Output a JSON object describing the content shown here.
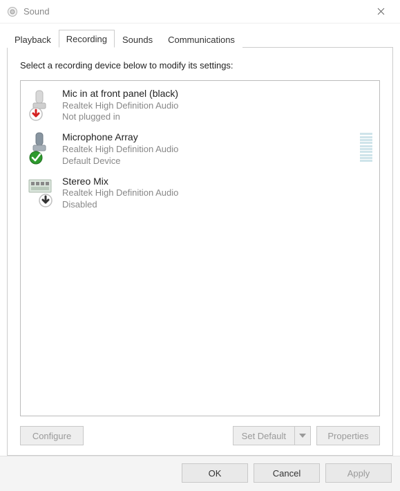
{
  "window": {
    "title": "Sound"
  },
  "tabs": [
    {
      "label": "Playback"
    },
    {
      "label": "Recording"
    },
    {
      "label": "Sounds"
    },
    {
      "label": "Communications"
    }
  ],
  "active_tab_index": 1,
  "instruction": "Select a recording device below to modify its settings:",
  "devices": [
    {
      "name": "Mic in at front panel (black)",
      "driver": "Realtek High Definition Audio",
      "status": "Not plugged in",
      "overlay": "unplugged"
    },
    {
      "name": "Microphone Array",
      "driver": "Realtek High Definition Audio",
      "status": "Default Device",
      "overlay": "default"
    },
    {
      "name": "Stereo Mix",
      "driver": "Realtek High Definition Audio",
      "status": "Disabled",
      "overlay": "disabled"
    }
  ],
  "panel_buttons": {
    "configure": "Configure",
    "set_default": "Set Default",
    "properties": "Properties"
  },
  "footer": {
    "ok": "OK",
    "cancel": "Cancel",
    "apply": "Apply"
  }
}
